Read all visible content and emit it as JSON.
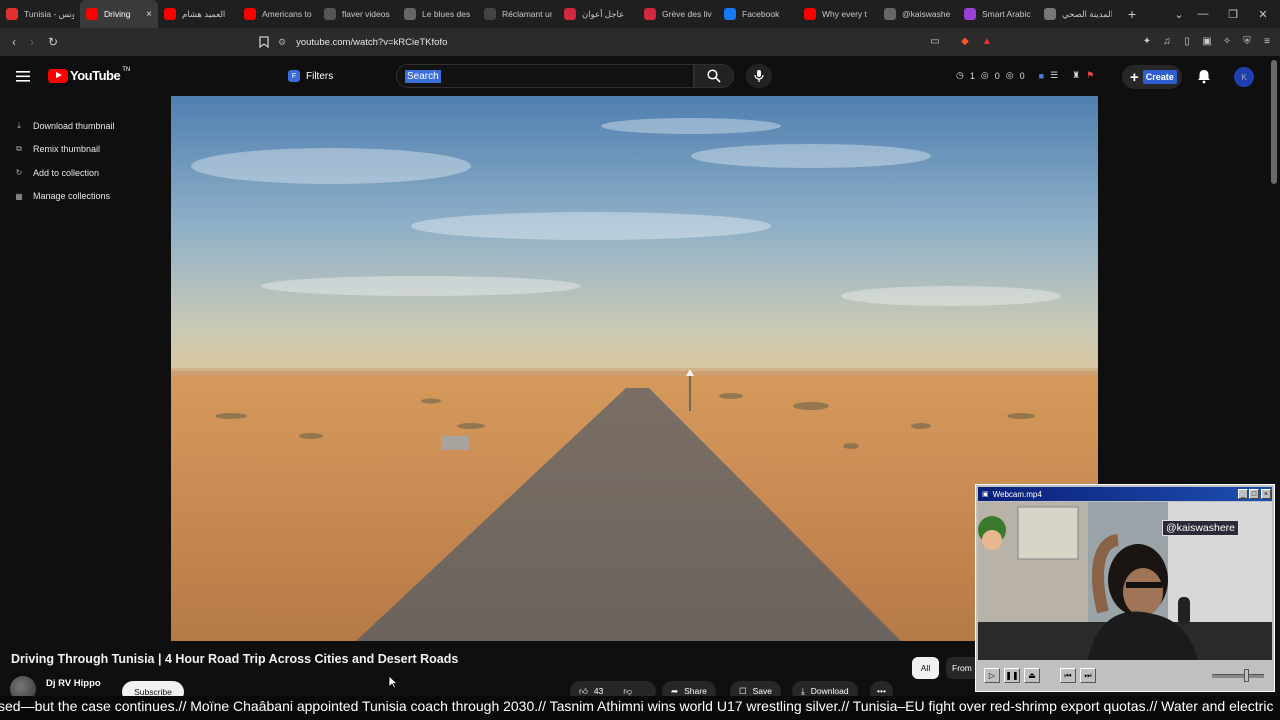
{
  "browser": {
    "tabs": [
      {
        "title": "Tunisia - تونس",
        "favicon": "youtube-icon",
        "color": "#e03030",
        "active": false
      },
      {
        "title": "Driving",
        "favicon": "youtube-icon",
        "color": "#ff0000",
        "active": true
      },
      {
        "title": "العميد هشام",
        "favicon": "youtube-icon",
        "color": "#ff0000",
        "active": false
      },
      {
        "title": "Americans to",
        "favicon": "youtube-icon",
        "color": "#ff0000",
        "active": false
      },
      {
        "title": "flaver videos",
        "favicon": "site-icon",
        "color": "#555555",
        "active": false
      },
      {
        "title": "Le blues des",
        "favicon": "globe-icon",
        "color": "#666666",
        "active": false
      },
      {
        "title": "Réclamant un",
        "favicon": "site-icon",
        "color": "#444444",
        "active": false
      },
      {
        "title": "عاجل أعوان",
        "favicon": "ts-icon",
        "color": "#d0283c",
        "active": false
      },
      {
        "title": "Grève des liv",
        "favicon": "ts-icon",
        "color": "#d0283c",
        "active": false
      },
      {
        "title": "Facebook",
        "favicon": "facebook-icon",
        "color": "#1877f2",
        "active": false
      },
      {
        "title": "Why every t",
        "favicon": "youtube-icon",
        "color": "#ff0000",
        "active": false
      },
      {
        "title": "@kaiswashe",
        "favicon": "globe-icon",
        "color": "#666666",
        "active": false
      },
      {
        "title": "Smart Arabic",
        "favicon": "site-icon",
        "color": "#9b3fd8",
        "active": false
      },
      {
        "title": "المدينة الصحي",
        "favicon": "globe-icon",
        "color": "#777777",
        "active": false
      }
    ],
    "close_glyph": "×",
    "new_tab_glyph": "+",
    "url": "youtube.com/watch?v=kRCieTKfofo"
  },
  "youtube": {
    "logo_text": "YouTube",
    "logo_badge": "TN",
    "filters_label": "Filters",
    "filters_icon_text": "F",
    "search_placeholder": "Search",
    "counters": [
      "1",
      "0",
      "0"
    ],
    "create_label": "Create",
    "avatar_letter": "K"
  },
  "context_menu": {
    "items": [
      {
        "label": "Download thumbnail",
        "icon": "⤓"
      },
      {
        "label": "Remix thumbnail",
        "icon": "⧉"
      },
      {
        "label": "Add to collection",
        "icon": "↻"
      },
      {
        "label": "Manage collections",
        "icon": "▦"
      }
    ]
  },
  "video": {
    "title": "Driving Through Tunisia | 4 Hour Road Trip Across Cities and Desert Roads",
    "channel": "Dj RV Hippo",
    "subscribe_label": "Subscribe",
    "like_count": "43",
    "share_label": "Share",
    "save_label": "Save",
    "download_label": "Download",
    "more_label": "•••",
    "chip_all": "All",
    "chip_from": "From"
  },
  "webcam": {
    "window_title": "Webcam.mp4",
    "handle_tag": "@kaiswashere"
  },
  "ticker": {
    "text": "sed—but the case continues.// Moïne Chaâbani appointed Tunisia coach through 2030.// Tasnim Athimni wins world U17 wrestling silver.// Tunisia–EU fight over red-shrimp export quotas.// Water and electric"
  },
  "colors": {
    "brand_red": "#ff0000",
    "selection_blue": "#3a6fd8",
    "webcam_titlebar": "#0a1f7a"
  }
}
